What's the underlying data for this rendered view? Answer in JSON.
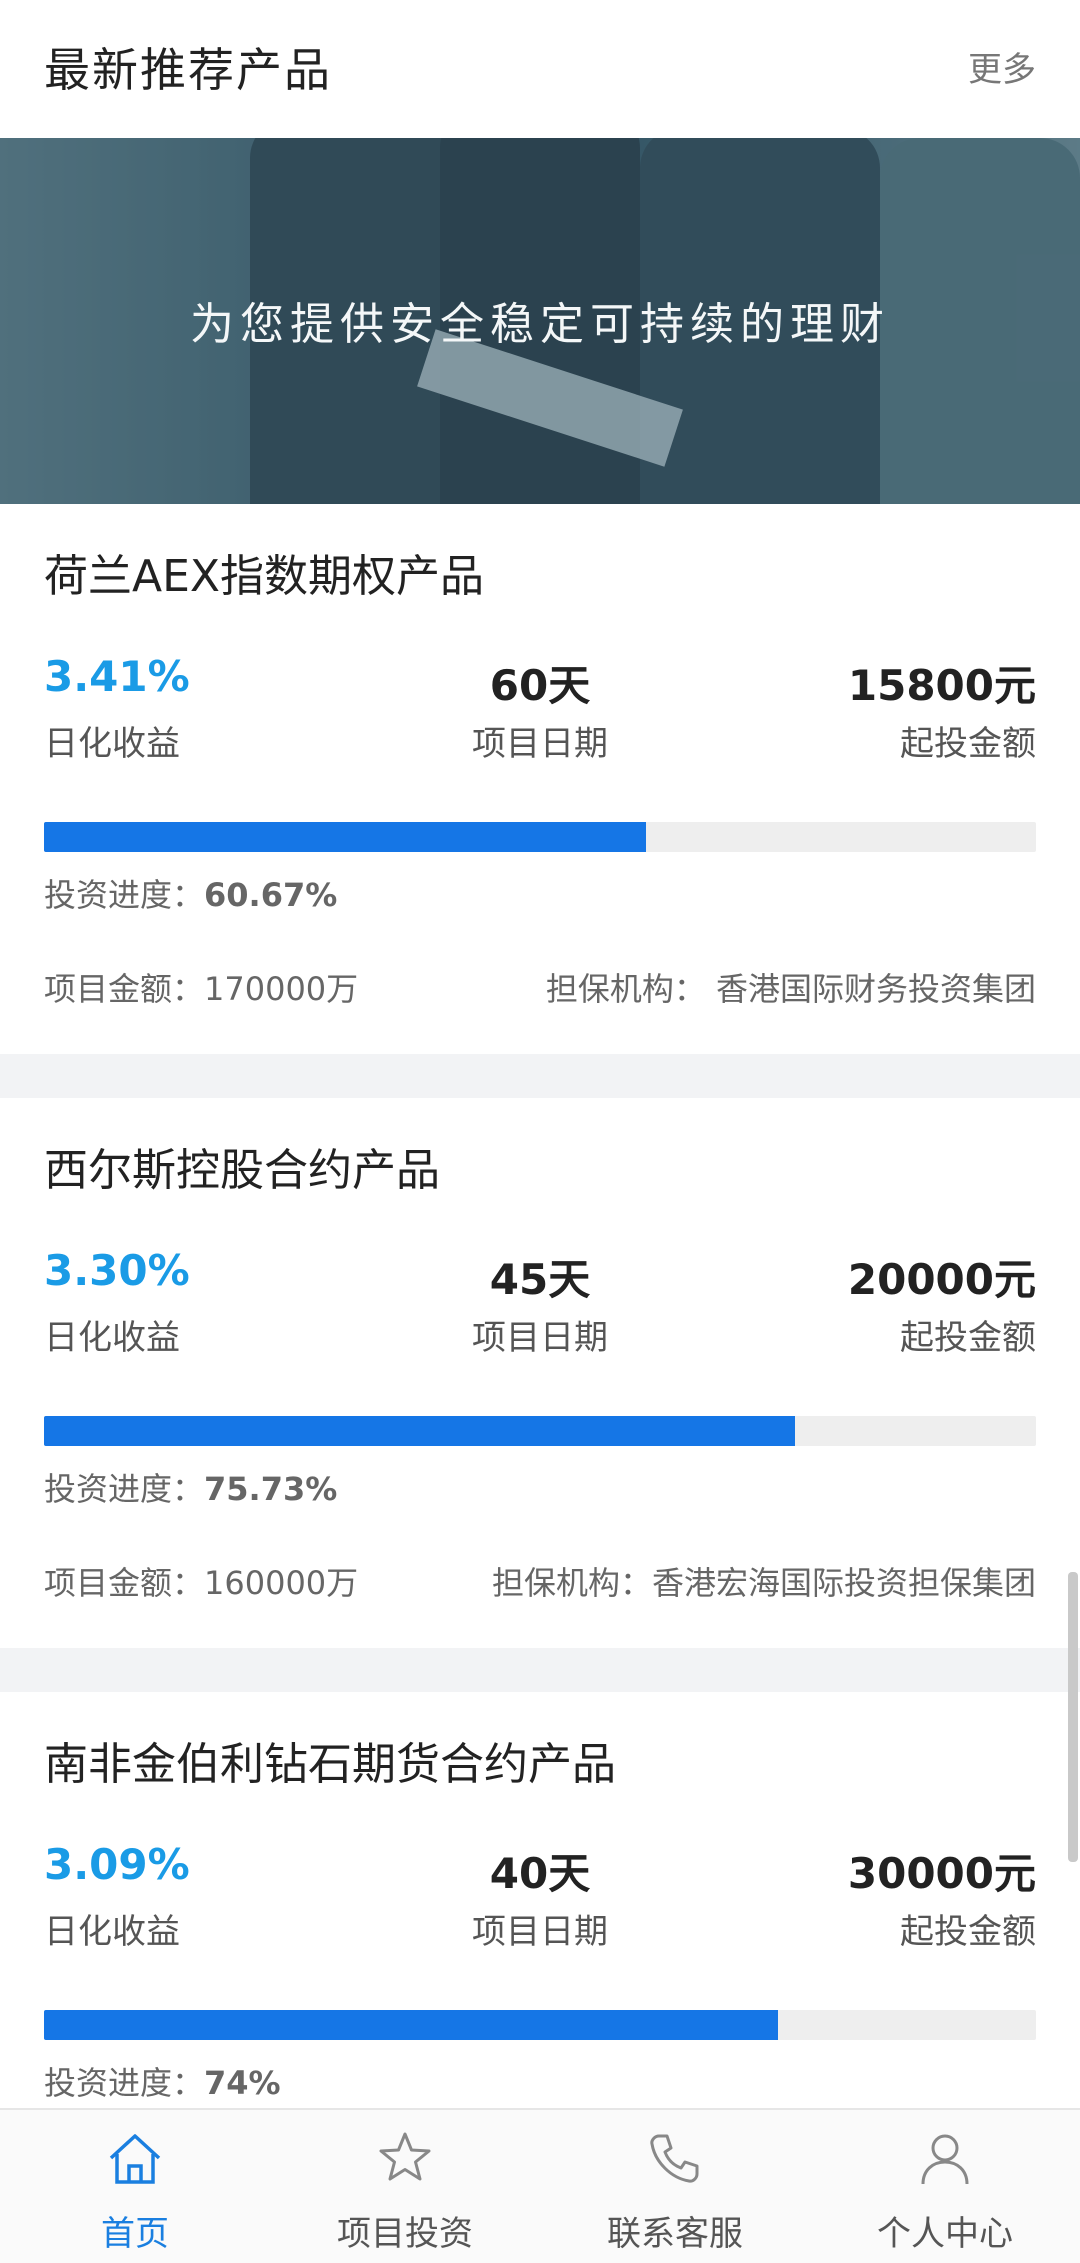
{
  "header": {
    "title": "最新推荐产品",
    "more": "更多"
  },
  "banner": {
    "text": "为您提供安全稳定可持续的理财"
  },
  "products": [
    {
      "name": "荷兰AEX指数期权产品",
      "rate": "3.41%",
      "rate_label": "日化收益",
      "period": "60天",
      "period_label": "项目日期",
      "min": "15800元",
      "min_label": "起投金额",
      "progress_label": "投资进度：",
      "progress_text": "60.67%",
      "progress": 60.67,
      "amount": "项目金额：170000万",
      "guarantor": "担保机构： 香港国际财务投资集团"
    },
    {
      "name": "西尔斯控股合约产品",
      "rate": "3.30%",
      "rate_label": "日化收益",
      "period": "45天",
      "period_label": "项目日期",
      "min": "20000元",
      "min_label": "起投金额",
      "progress_label": "投资进度：",
      "progress_text": "75.73%",
      "progress": 75.73,
      "amount": "项目金额：160000万",
      "guarantor": "担保机构：香港宏海国际投资担保集团"
    },
    {
      "name": "南非金伯利钻石期货合约产品",
      "rate": "3.09%",
      "rate_label": "日化收益",
      "period": "40天",
      "period_label": "项目日期",
      "min": "30000元",
      "min_label": "起投金额",
      "progress_label": "投资进度：",
      "progress_text": "74%",
      "progress": 74
    }
  ],
  "tabs": [
    {
      "label": "首页",
      "icon": "home-icon",
      "active": true
    },
    {
      "label": "项目投资",
      "icon": "star-icon",
      "active": false
    },
    {
      "label": "联系客服",
      "icon": "phone-icon",
      "active": false
    },
    {
      "label": "个人中心",
      "icon": "user-icon",
      "active": false
    }
  ],
  "colors": {
    "accent": "#1a9be6",
    "progress": "#1576e6",
    "tab_active": "#1a7fe0"
  }
}
